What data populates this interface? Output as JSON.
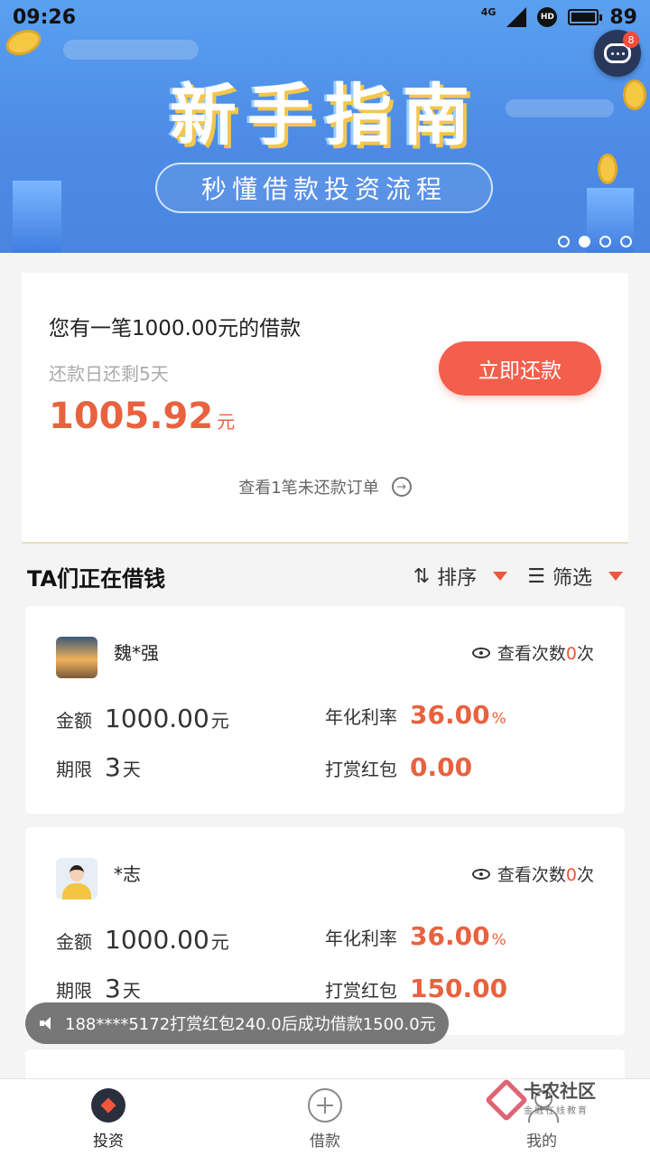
{
  "status_bar": {
    "time": "09:26",
    "network": "4G",
    "hd": "HD",
    "battery": "89"
  },
  "banner": {
    "title": "新手指南",
    "subtitle": "秒懂借款投资流程",
    "chat_badge": "8",
    "slides": 4,
    "active_slide": 2
  },
  "loan_card": {
    "title": "您有一笔1000.00元的借款",
    "due": "还款日还剩5天",
    "amount": "1005.92",
    "amount_unit": "元",
    "repay_button": "立即还款",
    "unpaid_link": "查看1笔未还款订单"
  },
  "list": {
    "title": "TA们正在借钱",
    "sort_label": "排序",
    "filter_label": "筛选",
    "borrowers": [
      {
        "name": "魏*强",
        "views_prefix": "查看次数",
        "views_count": "0",
        "views_suffix": "次",
        "amount_label": "金额",
        "amount": "1000.00",
        "amount_unit": "元",
        "rate_label": "年化利率",
        "rate": "36.00",
        "rate_unit": "%",
        "term_label": "期限",
        "term": "3",
        "term_unit": "天",
        "reward_label": "打赏红包",
        "reward": "0.00"
      },
      {
        "name": "*志",
        "views_prefix": "查看次数",
        "views_count": "0",
        "views_suffix": "次",
        "amount_label": "金额",
        "amount": "1000.00",
        "amount_unit": "元",
        "rate_label": "年化利率",
        "rate": "36.00",
        "rate_unit": "%",
        "term_label": "期限",
        "term": "3",
        "term_unit": "天",
        "reward_label": "打赏红包",
        "reward": "150.00"
      }
    ]
  },
  "toast": {
    "text": "188****5172打赏红包240.0后成功借款1500.0元"
  },
  "bottom_nav": [
    {
      "label": "投资",
      "icon": "invest-icon"
    },
    {
      "label": "借款",
      "icon": "plus-circle-icon"
    },
    {
      "label": "我的",
      "icon": "user-icon"
    }
  ],
  "watermark": {
    "main": "卡农社区",
    "sub": "金融在线教育"
  },
  "colors": {
    "accent": "#f35f4c",
    "banner": "#4d8be6",
    "amount": "#e8623f"
  }
}
